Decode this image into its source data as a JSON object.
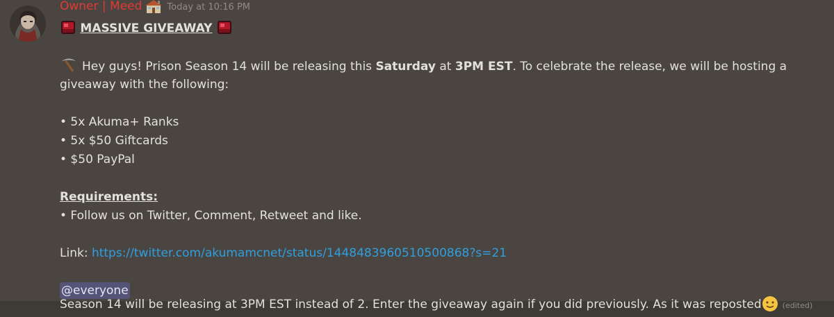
{
  "message": {
    "author": "Owner | Meed",
    "timestamp": "Today at 10:16 PM",
    "title": "MASSIVE GIVEAWAY",
    "intro_prefix": "Hey guys! Prison Season 14 will be releasing this ",
    "intro_bold_day": "Saturday",
    "intro_at": " at ",
    "intro_bold_time": "3PM EST",
    "intro_suffix_1": ". To celebrate the release, we will be hosting a",
    "intro_suffix_2": "giveaway with the following:",
    "prizes": [
      "• 5x Akuma+ Ranks",
      "• 5x $50 Giftcards",
      "• $50 PayPal"
    ],
    "requirements_heading": "Requirements:",
    "requirements": [
      "• Follow us on Twitter, Comment, Retweet and like."
    ],
    "link_label": "Link: ",
    "link_url": "https://twitter.com/akumamcnet/status/1448483960510500868?s=21",
    "mention": "@everyone"
  },
  "followup": {
    "text": "Season 14 will be releasing at 3PM EST instead of 2. Enter the giveaway again if you did previously. As it was reposted",
    "edited": "(edited)"
  },
  "icons": {
    "house": "house-icon",
    "ruby": "ruby-icon",
    "pick": "pick-icon",
    "smile": "slightly-smiling-face-icon"
  },
  "colors": {
    "background": "#4a4540",
    "username": "#e03a34",
    "link": "#2f9fe0",
    "mention_bg": "#535478"
  }
}
